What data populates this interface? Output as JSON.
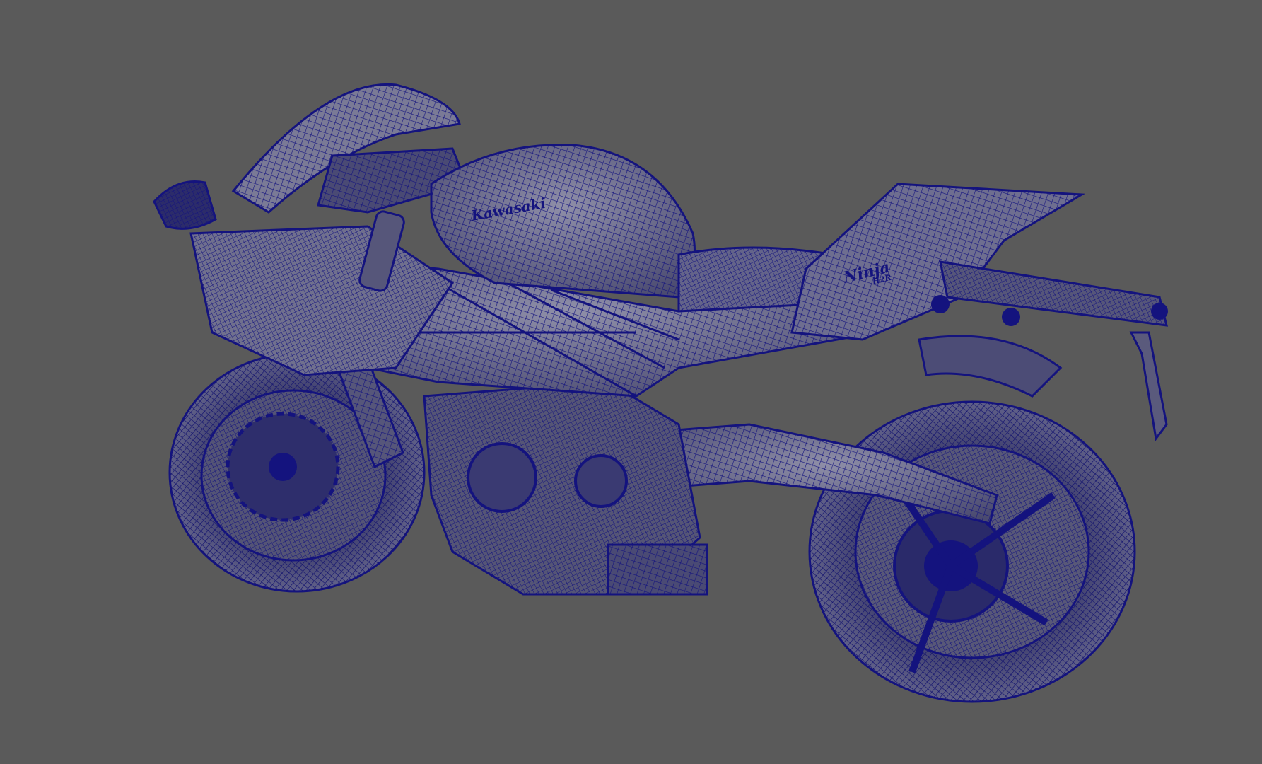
{
  "viewport": {
    "background_color": "#5a5a5a",
    "display_mode": "wireframe-on-shaded",
    "wire_color": "#14137e",
    "shade_color": "#6b6b86"
  },
  "model": {
    "subject": "motorcycle",
    "decals": {
      "tank_brand": "Kawasaki",
      "tail_model": "Ninja",
      "tail_submodel": "H2R"
    }
  }
}
